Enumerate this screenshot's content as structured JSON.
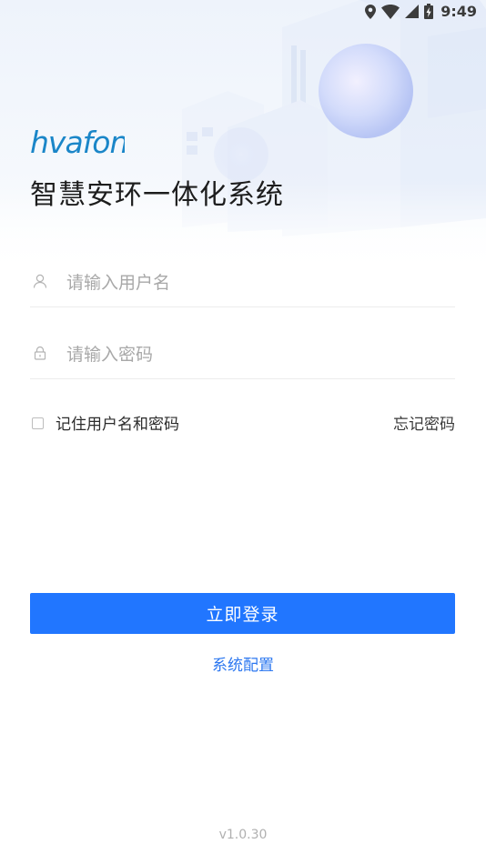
{
  "status_bar": {
    "time": "9:49",
    "icons": [
      "location-icon",
      "wifi-icon",
      "cell-signal-icon",
      "battery-icon"
    ]
  },
  "brand": {
    "logo_text": "hvafon",
    "logo_color": "#1a86c8"
  },
  "app": {
    "title": "智慧安环一体化系统"
  },
  "form": {
    "username_placeholder": "请输入用户名",
    "username_value": "",
    "password_placeholder": "请输入密码",
    "password_value": "",
    "remember_label": "记住用户名和密码",
    "remember_checked": false,
    "forgot_label": "忘记密码"
  },
  "actions": {
    "login_label": "立即登录",
    "config_label": "系统配置"
  },
  "footer": {
    "version": "v1.0.30"
  },
  "colors": {
    "primary": "#2176ff",
    "link": "#2d78f0",
    "placeholder": "#a8a8a8",
    "divider": "#ececec"
  }
}
